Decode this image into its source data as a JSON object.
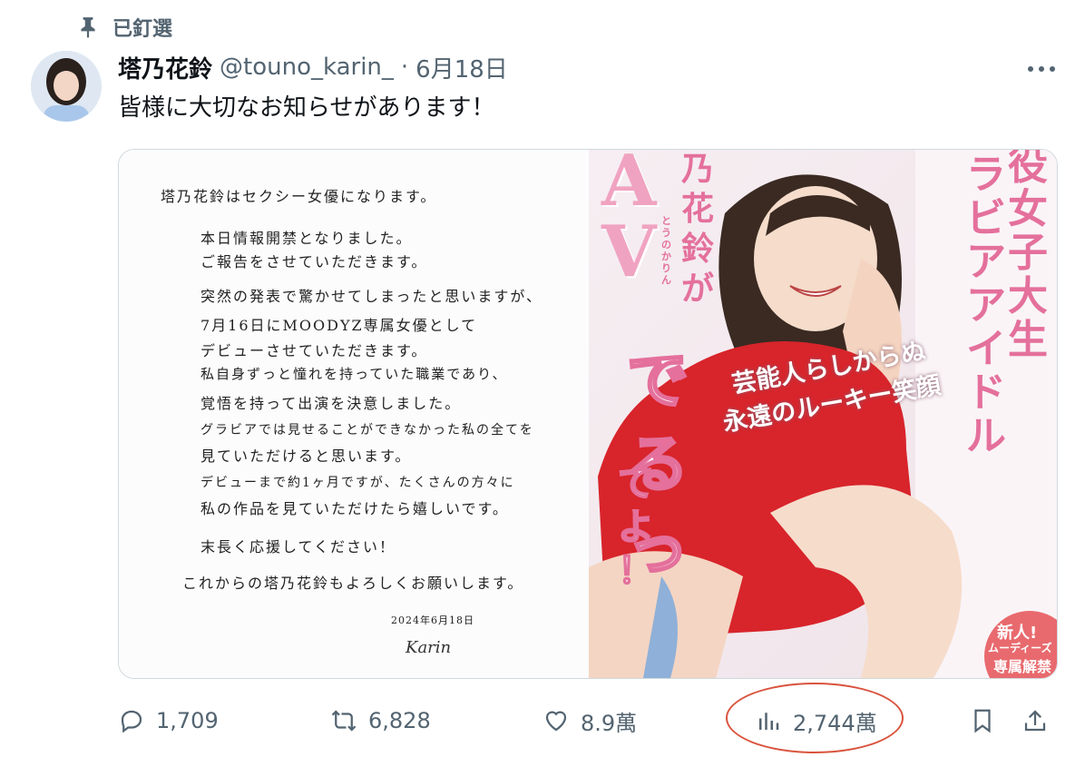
{
  "pin": {
    "label": "已釘選",
    "icon": "pin-icon"
  },
  "author": {
    "name": "塔乃花鈴",
    "handle": "@touno_karin_",
    "separator": "·",
    "date": "6月18日"
  },
  "tweet": {
    "text": "皆様に大切なお知らせがあります！"
  },
  "media": {
    "letter": {
      "lines": [
        "塔乃花鈴はセクシー女優になります。",
        "本日情報開禁となりました。",
        "ご報告をさせていただきます。",
        "突然の発表で驚かせてしまったと思いますが、",
        "7月16日にMOODYZ専属女優として",
        "デビューさせていただきます。",
        "私自身ずっと憧れを持っていた職業であり、",
        "覚悟を持って出演を決意しました。",
        "グラビアでは見せることができなかった私の全てを",
        "見ていただけると思います。",
        "デビューまで約1ヶ月ですが、たくさんの方々に",
        "私の作品を見ていただけたら嬉しいです。",
        "末長く応援してください！",
        "これからの塔乃花鈴もよろしくお願いします。"
      ],
      "date": "2024年6月18日",
      "signature": "Karin"
    },
    "photo": {
      "av": "AV",
      "name_vertical": "乃花鈴が",
      "furigana": "とうのかりん",
      "debut": "でるっ",
      "teyo": "てよ！",
      "tagline_1": "芸能人らしからぬ",
      "tagline_2": "永遠のルーキー笑顔",
      "col_1": "役女子大生",
      "col_2": "ラビアアイドル",
      "badge_1": "新人!",
      "badge_2": "ムーディーズ",
      "badge_3": "専属解禁"
    }
  },
  "actions": {
    "replies": "1,709",
    "reposts": "6,828",
    "likes": "8.9萬",
    "views": "2,744萬"
  },
  "colors": {
    "text": "#0f1419",
    "secondary": "#536471",
    "border": "#cfd9de",
    "highlight": "#d9533d",
    "shirt": "#d8242b",
    "pink": "#e4709b"
  }
}
